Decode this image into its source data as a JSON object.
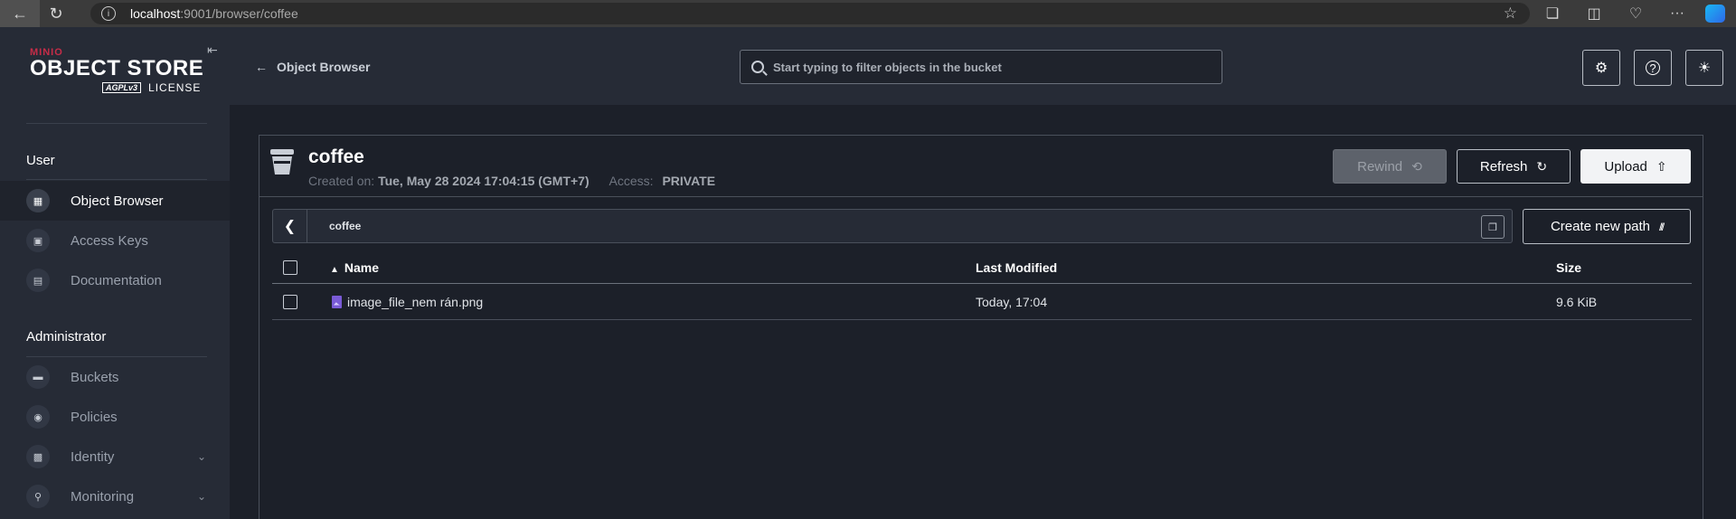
{
  "browser": {
    "url_host": "localhost",
    "url_path": ":9001/browser/coffee",
    "icons": [
      "back-arrow-icon",
      "reload-icon",
      "info-icon",
      "star-icon",
      "extensions-icon",
      "split-screen-icon",
      "browser-health-icon",
      "more-icon",
      "copilot-icon"
    ]
  },
  "sidebar": {
    "logo": {
      "brand": "MINIO",
      "product": "OBJECT STORE",
      "agpl": "AGPLv3",
      "license": "LICENSE"
    },
    "sections": [
      {
        "label": "User",
        "items": [
          {
            "label": "Object Browser",
            "icon": "object-browser-icon",
            "active": true
          },
          {
            "label": "Access Keys",
            "icon": "access-keys-icon",
            "active": false
          },
          {
            "label": "Documentation",
            "icon": "documentation-icon",
            "active": false
          }
        ]
      },
      {
        "label": "Administrator",
        "items": [
          {
            "label": "Buckets",
            "icon": "buckets-icon",
            "active": false
          },
          {
            "label": "Policies",
            "icon": "policies-icon",
            "active": false
          },
          {
            "label": "Identity",
            "icon": "identity-icon",
            "active": false,
            "expandable": true
          },
          {
            "label": "Monitoring",
            "icon": "monitoring-icon",
            "active": false,
            "expandable": true
          }
        ]
      }
    ]
  },
  "header": {
    "back_label": "Object Browser",
    "search_placeholder": "Start typing to filter objects in the bucket",
    "buttons": [
      "settings-icon",
      "help-icon",
      "theme-toggle-icon"
    ]
  },
  "bucket": {
    "name": "coffee",
    "created_label": "Created on:",
    "created_value": "Tue, May 28 2024 17:04:15 (GMT+7)",
    "access_label": "Access:",
    "access_value": "PRIVATE",
    "rewind_label": "Rewind",
    "refresh_label": "Refresh",
    "upload_label": "Upload",
    "rewind_disabled": true
  },
  "path_bar": {
    "path": "coffee",
    "create_path_label": "Create new path"
  },
  "table": {
    "headers": {
      "name": "Name",
      "modified": "Last Modified",
      "size": "Size"
    },
    "sort": "name-ascending",
    "rows": [
      {
        "name": "image_file_nem rán.png",
        "modified": "Today, 17:04",
        "size": "9.6 KiB"
      }
    ]
  },
  "colors": {
    "background": "#1c2029",
    "sidebar": "#262b36",
    "brand_red": "#c72c48",
    "upload_button": "#f2f3f5"
  }
}
